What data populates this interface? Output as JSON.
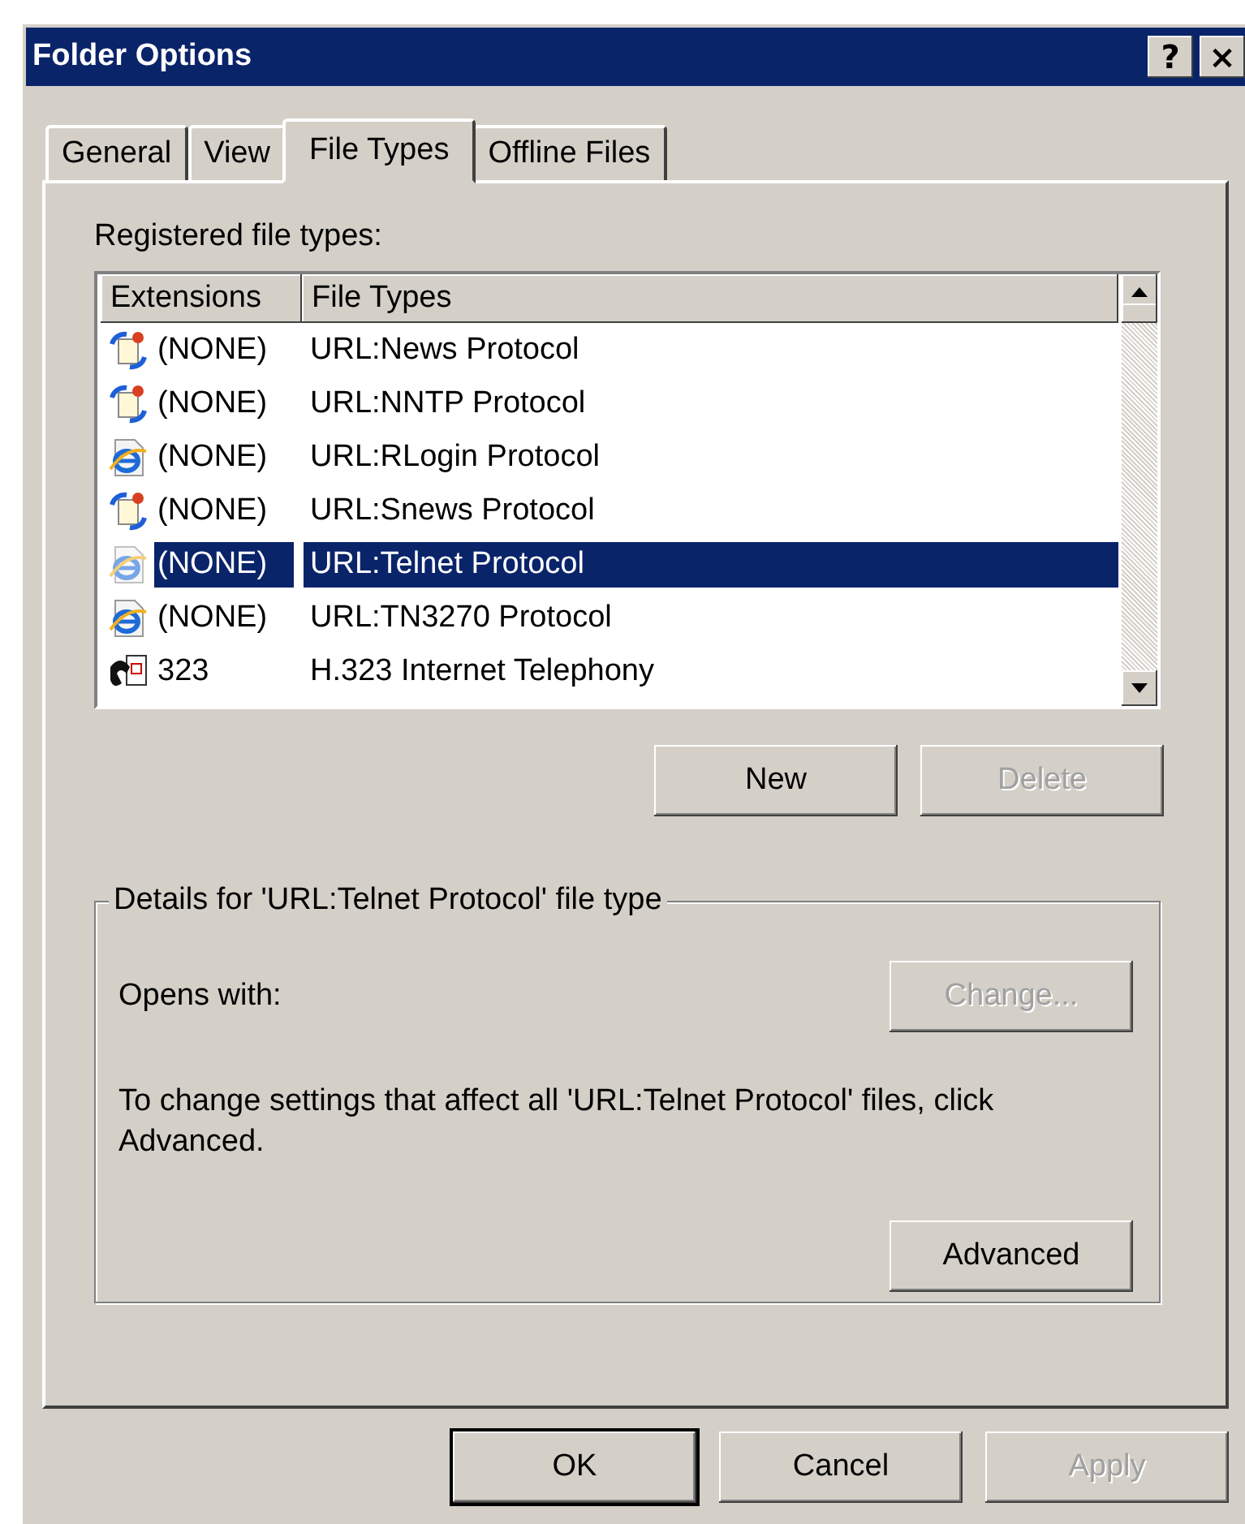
{
  "window": {
    "title": "Folder Options",
    "help_button": "?",
    "close_button": "×"
  },
  "tabs": [
    {
      "label": "General",
      "selected": false
    },
    {
      "label": "View",
      "selected": false
    },
    {
      "label": "File Types",
      "selected": true
    },
    {
      "label": "Offline Files",
      "selected": false
    }
  ],
  "list_label": "Registered file types:",
  "table": {
    "columns": [
      "Extensions",
      "File Types"
    ],
    "rows": [
      {
        "kind": "protocol",
        "extension": "(NONE)",
        "file_type": "URL:News Protocol",
        "selected": false
      },
      {
        "kind": "protocol",
        "extension": "(NONE)",
        "file_type": "URL:NNTP Protocol",
        "selected": false
      },
      {
        "kind": "browser",
        "extension": "(NONE)",
        "file_type": "URL:RLogin Protocol",
        "selected": false
      },
      {
        "kind": "protocol",
        "extension": "(NONE)",
        "file_type": "URL:Snews Protocol",
        "selected": false
      },
      {
        "kind": "browser",
        "extension": "(NONE)",
        "file_type": "URL:Telnet Protocol",
        "selected": true
      },
      {
        "kind": "browser",
        "extension": "(NONE)",
        "file_type": "URL:TN3270 Protocol",
        "selected": false
      },
      {
        "kind": "phone",
        "extension": "323",
        "file_type": "H.323 Internet Telephony",
        "selected": false
      }
    ]
  },
  "list_buttons": [
    {
      "label": "New",
      "disabled": false
    },
    {
      "label": "Delete",
      "disabled": true
    }
  ],
  "details": {
    "legend": "Details for 'URL:Telnet Protocol' file type",
    "opens_with": "Opens with:",
    "change_button": {
      "label": "Change...",
      "disabled": true
    },
    "description": "To change settings that affect all 'URL:Telnet Protocol' files, click Advanced.",
    "advanced_button": {
      "label": "Advanced",
      "disabled": false
    }
  },
  "buttons": [
    {
      "label": "OK",
      "default": true,
      "disabled": false
    },
    {
      "label": "Cancel",
      "default": false,
      "disabled": false
    },
    {
      "label": "Apply",
      "default": false,
      "disabled": true
    }
  ]
}
